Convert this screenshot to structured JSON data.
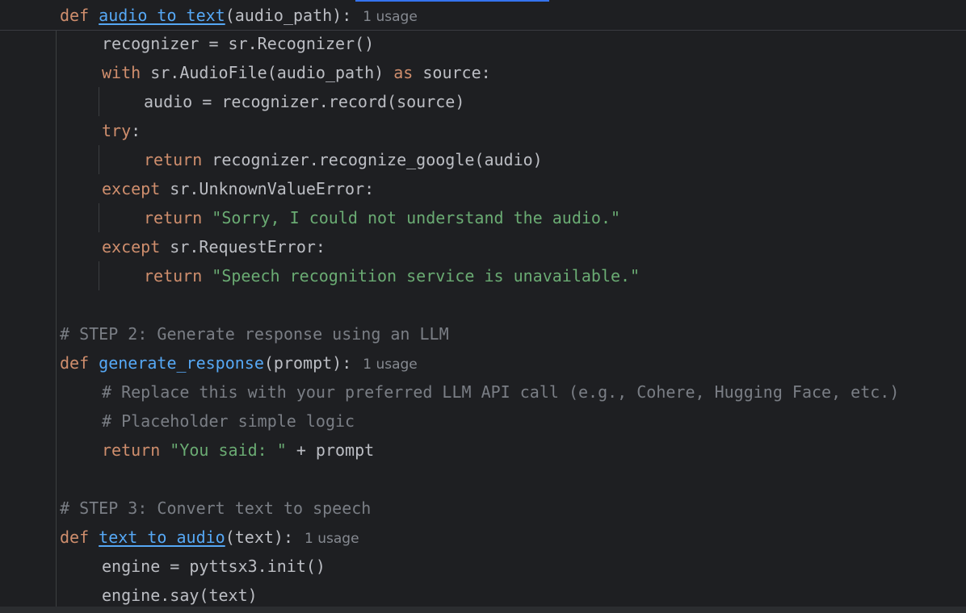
{
  "editor": {
    "language": "python",
    "colors": {
      "background": "#1e1f22",
      "keyword": "#cf8e6d",
      "function": "#56a8f5",
      "string": "#6aab73",
      "comment": "#7a7e85",
      "text": "#bcbec4",
      "usage_hint": "#868a91"
    }
  },
  "code": {
    "l0": {
      "kw": "def ",
      "fn": "audio_to_text",
      "rest": "(audio_path):",
      "usage": "1 usage"
    },
    "l1": {
      "text": "recognizer = sr.Recognizer()"
    },
    "l2": {
      "kw": "with",
      "mid": " sr.AudioFile(audio_path) ",
      "kw2": "as",
      "rest": " source:"
    },
    "l3": {
      "text": "audio = recognizer.record(source)"
    },
    "l4": {
      "kw": "try",
      "rest": ":"
    },
    "l5": {
      "kw": "return",
      "rest": " recognizer.recognize_google(audio)"
    },
    "l6": {
      "kw": "except",
      "rest": " sr.UnknownValueError:"
    },
    "l7": {
      "kw": "return",
      "sp": " ",
      "str": "\"Sorry, I could not understand the audio.\""
    },
    "l8": {
      "kw": "except",
      "rest": " sr.RequestError:"
    },
    "l9": {
      "kw": "return",
      "sp": " ",
      "str": "\"Speech recognition service is unavailable.\""
    },
    "l11": {
      "comment": "# STEP 2: Generate response using an LLM"
    },
    "l12": {
      "kw": "def ",
      "fn": "generate_response",
      "rest": "(prompt):",
      "usage": "1 usage"
    },
    "l13": {
      "comment": "# Replace this with your preferred LLM API call (e.g., Cohere, Hugging Face, etc.)"
    },
    "l14": {
      "comment": "# Placeholder simple logic"
    },
    "l15": {
      "kw": "return",
      "sp": " ",
      "str": "\"You said: \"",
      "rest": " + prompt"
    },
    "l17": {
      "comment": "# STEP 3: Convert text to speech"
    },
    "l18": {
      "kw": "def ",
      "fn": "text_to_audio",
      "rest": "(text):",
      "usage": "1 usage"
    },
    "l19": {
      "text": "engine = pyttsx3.init()"
    },
    "l20": {
      "text": "engine.say(text)"
    }
  }
}
